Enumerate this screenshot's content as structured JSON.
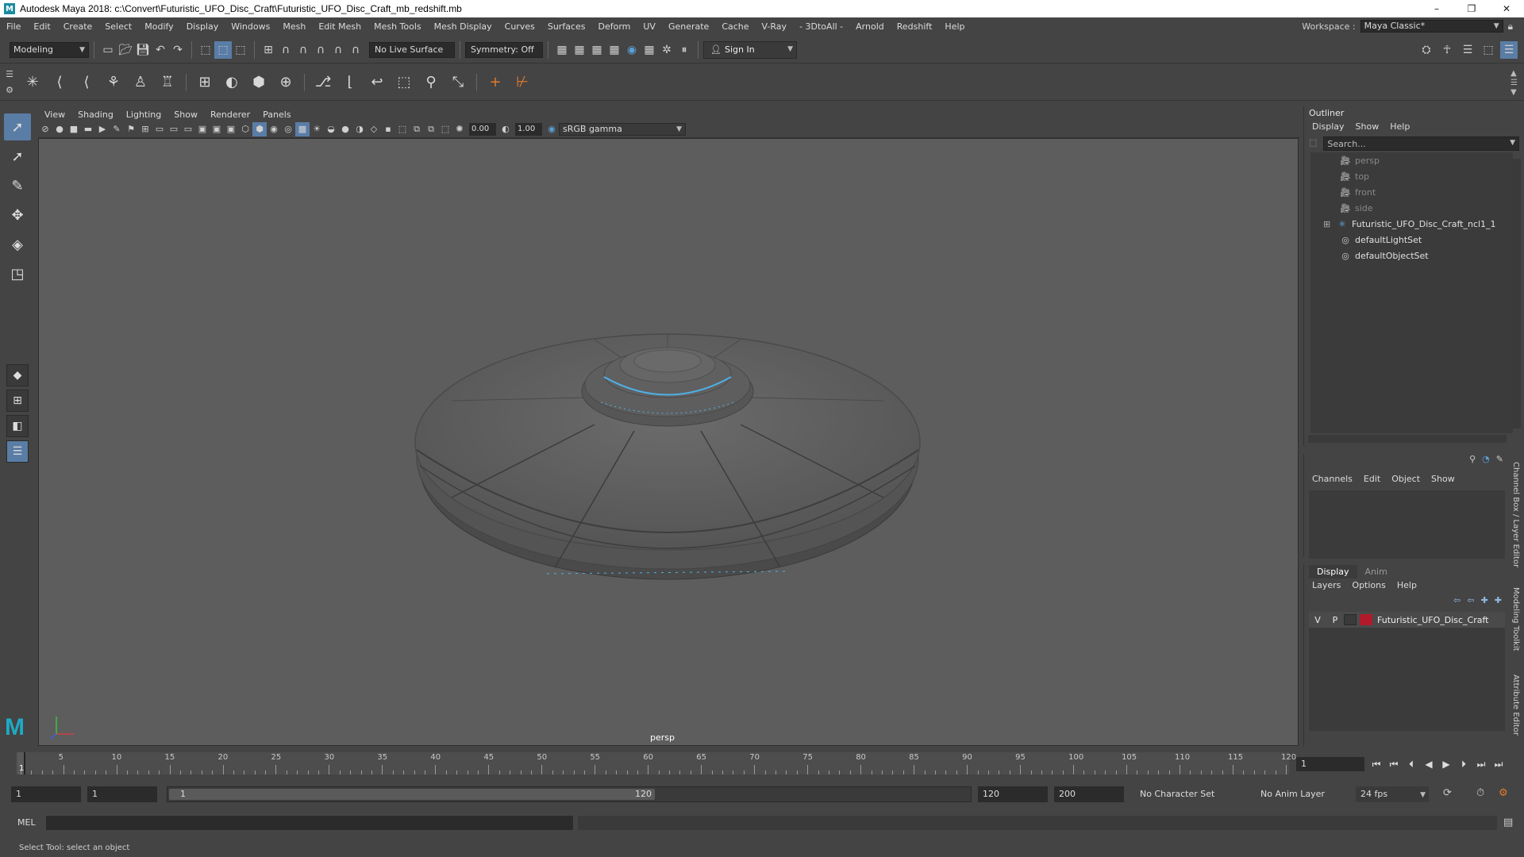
{
  "window": {
    "title": "Autodesk Maya 2018: c:\\Convert\\Futuristic_UFO_Disc_Craft\\Futuristic_UFO_Disc_Craft_mb_redshift.mb",
    "app_icon": "M",
    "min": "–",
    "max": "❐",
    "close": "✕"
  },
  "menubar": {
    "items": [
      "File",
      "Edit",
      "Create",
      "Select",
      "Modify",
      "Display",
      "Windows",
      "Mesh",
      "Edit Mesh",
      "Mesh Tools",
      "Mesh Display",
      "Curves",
      "Surfaces",
      "Deform",
      "UV",
      "Generate",
      "Cache",
      "V-Ray",
      "- 3DtoAll -",
      "Arnold",
      "Redshift",
      "Help"
    ],
    "workspace_label": "Workspace :",
    "workspace_value": "Maya Classic*"
  },
  "statusline": {
    "menuset": "Modeling",
    "live_surface": "No Live Surface",
    "symmetry": "Symmetry: Off",
    "signin": "Sign In"
  },
  "viewport": {
    "menu": [
      "View",
      "Shading",
      "Lighting",
      "Show",
      "Renderer",
      "Panels"
    ],
    "exposure": "0.00",
    "gamma": "1.00",
    "colorspace": "sRGB gamma",
    "camera": "persp"
  },
  "outliner": {
    "title": "Outliner",
    "menu": [
      "Display",
      "Show",
      "Help"
    ],
    "search_placeholder": "Search...",
    "items": [
      {
        "label": "persp",
        "icon": "camera-icon",
        "dim": true
      },
      {
        "label": "top",
        "icon": "camera-icon",
        "dim": true
      },
      {
        "label": "front",
        "icon": "camera-icon",
        "dim": true
      },
      {
        "label": "side",
        "icon": "camera-icon",
        "dim": true
      },
      {
        "label": "Futuristic_UFO_Disc_Craft_ncl1_1",
        "icon": "group-icon",
        "dim": false,
        "expand": "⊞"
      },
      {
        "label": "defaultLightSet",
        "icon": "set-icon",
        "dim": false
      },
      {
        "label": "defaultObjectSet",
        "icon": "set-icon",
        "dim": false
      }
    ]
  },
  "channelbox": {
    "menu": [
      "Channels",
      "Edit",
      "Object",
      "Show"
    ]
  },
  "layereditor": {
    "tabs": [
      "Display",
      "Anim"
    ],
    "menu": [
      "Layers",
      "Options",
      "Help"
    ],
    "layer": {
      "v": "V",
      "p": "P",
      "name": "Futuristic_UFO_Disc_Craft",
      "color": "#b01a2a"
    }
  },
  "sidetabs": [
    "Channel Box / Layer Editor",
    "Modeling Toolkit",
    "Attribute Editor"
  ],
  "timeslider": {
    "ticks": [
      "5",
      "10",
      "15",
      "20",
      "25",
      "30",
      "35",
      "40",
      "45",
      "50",
      "55",
      "60",
      "65",
      "70",
      "75",
      "80",
      "85",
      "90",
      "95",
      "100",
      "105",
      "110",
      "115",
      "120"
    ],
    "current": "1",
    "current_field": "1"
  },
  "rangeslider": {
    "start": "1",
    "anim_start": "1",
    "range_start": "1",
    "range_end": "120",
    "anim_end": "120",
    "end": "200",
    "character_set": "No Character Set",
    "anim_layer": "No Anim Layer",
    "fps": "24 fps"
  },
  "cmdline": {
    "label": "MEL"
  },
  "helpline": "Select Tool: select an object"
}
